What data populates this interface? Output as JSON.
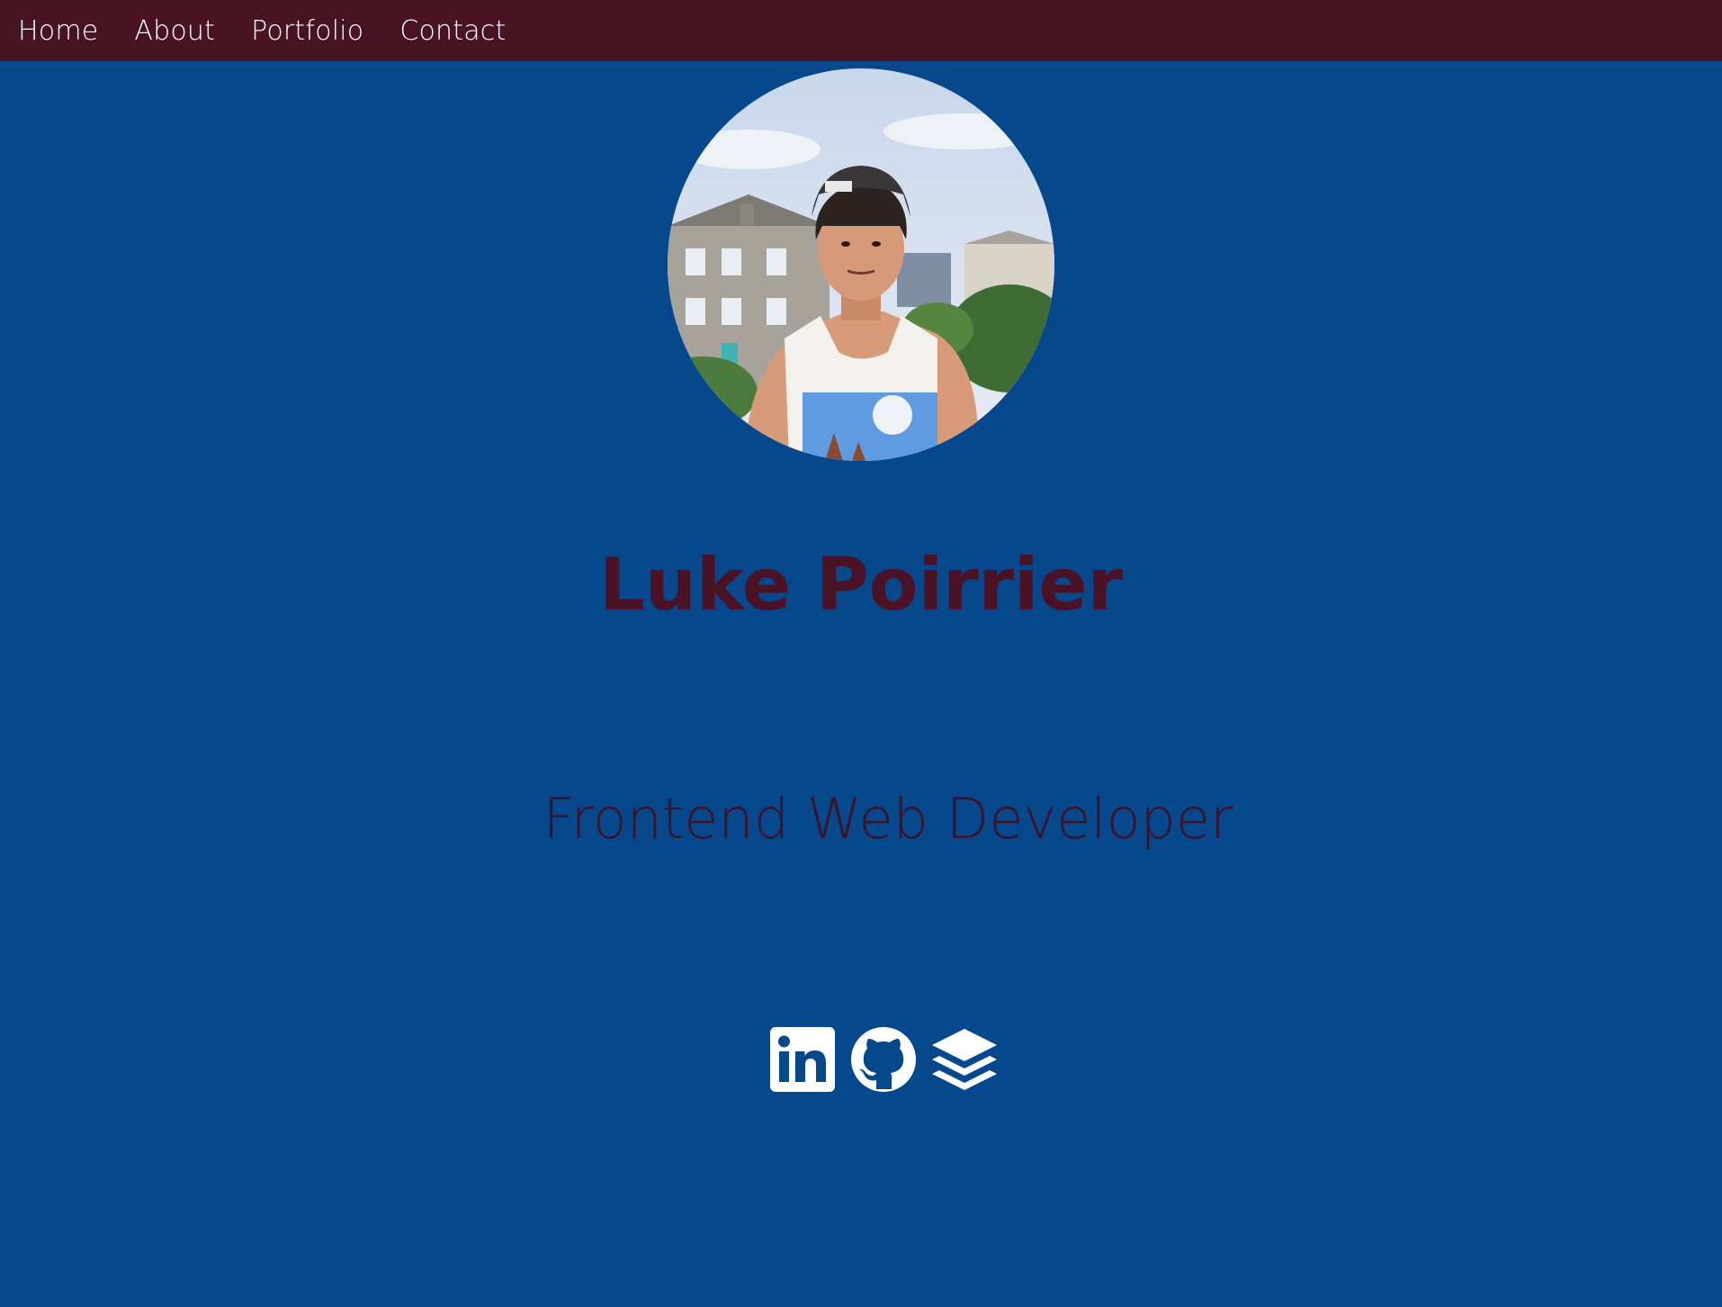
{
  "nav": {
    "items": [
      {
        "label": "Home"
      },
      {
        "label": "About"
      },
      {
        "label": "Portfolio"
      },
      {
        "label": "Contact"
      }
    ]
  },
  "profile": {
    "name": "Luke Poirrier",
    "title": "Frontend Web Developer"
  },
  "socials": [
    {
      "icon": "linkedin-icon"
    },
    {
      "icon": "github-icon"
    },
    {
      "icon": "stack-layers-icon"
    }
  ],
  "colors": {
    "background": "#06488c",
    "navbar": "#481322",
    "name": "#4a1224",
    "title": "#3e1227",
    "icons": "#ffffff"
  }
}
